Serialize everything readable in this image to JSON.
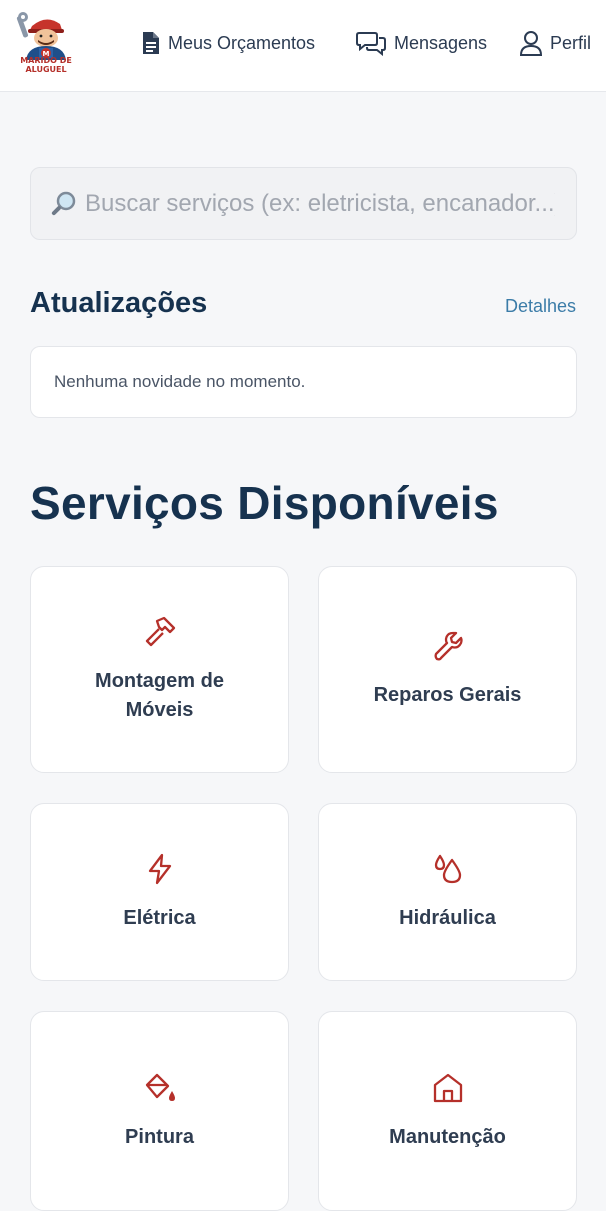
{
  "header": {
    "logo_text": "MARIDO DE ALUGUEL",
    "nav": [
      {
        "label": "Meus Orçamentos",
        "icon": "document-icon"
      },
      {
        "label": "Mensagens",
        "icon": "chat-bubbles-icon"
      },
      {
        "label": "Perfil",
        "icon": "user-icon"
      }
    ]
  },
  "search": {
    "placeholder": "Buscar serviços (ex: eletricista, encanador...)",
    "value": "",
    "icon": "magnifier-icon"
  },
  "updates": {
    "title": "Atualizações",
    "link": "Detalhes",
    "message": "Nenhuma novidade no momento."
  },
  "services": {
    "title": "Serviços Disponíveis",
    "items": [
      {
        "label": "Montagem de Móveis",
        "icon": "hammer-icon"
      },
      {
        "label": "Reparos Gerais",
        "icon": "wrench-icon"
      },
      {
        "label": "Elétrica",
        "icon": "lightning-icon"
      },
      {
        "label": "Hidráulica",
        "icon": "water-drops-icon"
      },
      {
        "label": "Pintura",
        "icon": "paint-bucket-icon"
      },
      {
        "label": "Manutenção",
        "icon": "house-icon"
      }
    ]
  },
  "colors": {
    "accent": "#b5302a",
    "heading": "#16324f",
    "link": "#3b7ca8",
    "background": "#f6f7f9"
  }
}
